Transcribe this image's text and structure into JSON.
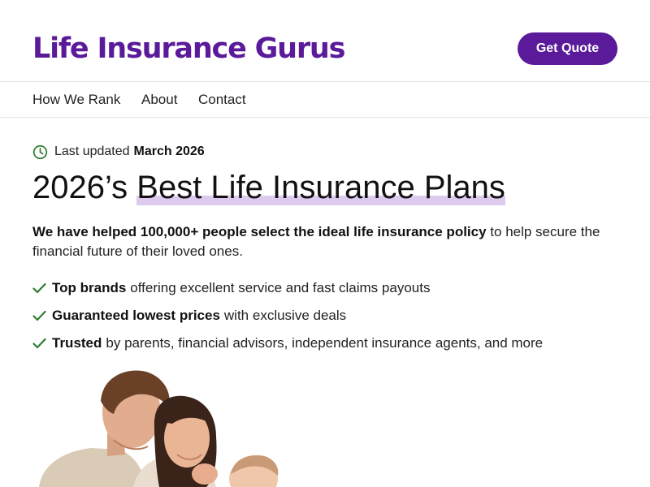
{
  "header": {
    "logo_text": "Life Insurance Gurus",
    "cta_label": "Get Quote"
  },
  "nav": {
    "items": [
      "How We Rank",
      "About",
      "Contact"
    ]
  },
  "hero": {
    "updated_prefix": "Last updated",
    "updated_date": "March 2026",
    "headline_prefix": "2026’s",
    "headline_highlight": "Best Life Insurance Plans",
    "intro_bold": "We have helped 100,000+ people select the ideal life insurance policy",
    "intro_rest": "to help secure the financial future of their loved ones.",
    "features": [
      {
        "bold": "Top brands",
        "text": "offering excellent service and fast claims payouts"
      },
      {
        "bold": "Guaranteed lowest prices",
        "text": "with exclusive deals"
      },
      {
        "bold": "Trusted",
        "text": "by parents, financial advisors, independent insurance agents, and more"
      }
    ]
  },
  "icons": {
    "updated": "clock-icon",
    "feature": "checkmark-icon"
  },
  "colors": {
    "brand": "#5a1a9a",
    "highlight": "#dccbef",
    "check": "#2e7d32"
  }
}
